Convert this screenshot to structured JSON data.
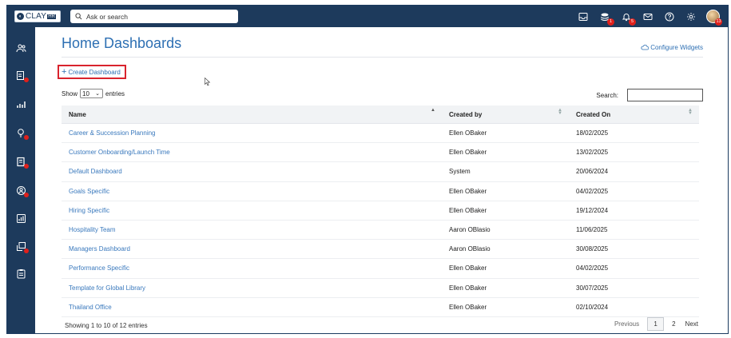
{
  "app": {
    "logo_text": "CLAY",
    "logo_suffix": "HR",
    "search_placeholder": "Ask or search",
    "badges": {
      "bundles": "1",
      "notifications": "5",
      "avatar": "13"
    }
  },
  "page": {
    "title": "Home Dashboards",
    "configure_label": "Configure Widgets",
    "create_label": "Create Dashboard",
    "show_label": "Show",
    "entries_value": "10",
    "entries_label": "entries",
    "search_label": "Search:",
    "search_value": ""
  },
  "table": {
    "headers": {
      "name": "Name",
      "created_by": "Created by",
      "created_on": "Created On"
    },
    "rows": [
      {
        "name": "Career & Succession Planning",
        "created_by": "Ellen OBaker",
        "created_on": "18/02/2025"
      },
      {
        "name": "Customer Onboarding/Launch Time",
        "created_by": "Ellen OBaker",
        "created_on": "13/02/2025"
      },
      {
        "name": "Default Dashboard",
        "created_by": "System",
        "created_on": "20/06/2024"
      },
      {
        "name": "Goals Specific",
        "created_by": "Ellen OBaker",
        "created_on": "04/02/2025"
      },
      {
        "name": "Hiring Specific",
        "created_by": "Ellen OBaker",
        "created_on": "19/12/2024"
      },
      {
        "name": "Hospitality Team",
        "created_by": "Aaron OBlasio",
        "created_on": "11/06/2025"
      },
      {
        "name": "Managers Dashboard",
        "created_by": "Aaron OBlasio",
        "created_on": "30/08/2025"
      },
      {
        "name": "Performance Specific",
        "created_by": "Ellen OBaker",
        "created_on": "04/02/2025"
      },
      {
        "name": "Template for Global Library",
        "created_by": "Ellen OBaker",
        "created_on": "30/07/2025"
      },
      {
        "name": "Thailand Office",
        "created_by": "Ellen OBaker",
        "created_on": "02/10/2024"
      }
    ]
  },
  "footer": {
    "info": "Showing 1 to 10 of 12 entries",
    "previous": "Previous",
    "page1": "1",
    "page2": "2",
    "next": "Next"
  },
  "colors": {
    "navy": "#1d3a5c",
    "link": "#2d6fb3",
    "badge": "#e0201b",
    "highlight": "#d9232d"
  }
}
